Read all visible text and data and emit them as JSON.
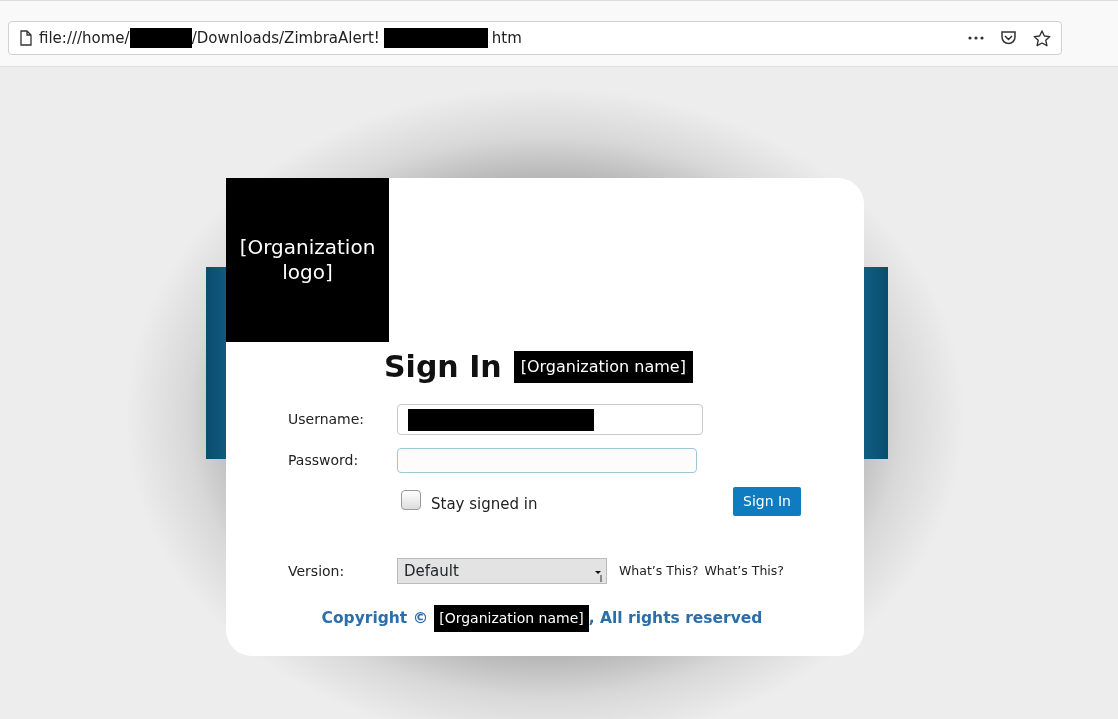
{
  "address_bar": {
    "parts": [
      {
        "kind": "text",
        "text": "file:///home/"
      },
      {
        "kind": "redacted"
      },
      {
        "kind": "text",
        "text": "/Downloads/ZimbraAlert!"
      },
      {
        "kind": "redacted"
      },
      {
        "kind": "text",
        "text": "htm"
      }
    ]
  },
  "login": {
    "logo_placeholder": "[Organization logo]",
    "title": "Sign In",
    "org_name": "[Organization name]",
    "fields": [
      {
        "label": "Username:",
        "redacted": true,
        "focused": false
      },
      {
        "label": "Password:",
        "redacted": false,
        "focused": true
      }
    ],
    "stay_signed_in": {
      "label": "Stay signed in",
      "checked": false
    },
    "submit": "Sign In",
    "version": {
      "label": "Version:",
      "value": "Default",
      "links": [
        "What’s This?",
        "What’s This?"
      ]
    },
    "copyright": {
      "before": "Copyright ©",
      "org_name": "[Organization name]",
      "after": ", All rights reserved"
    }
  }
}
